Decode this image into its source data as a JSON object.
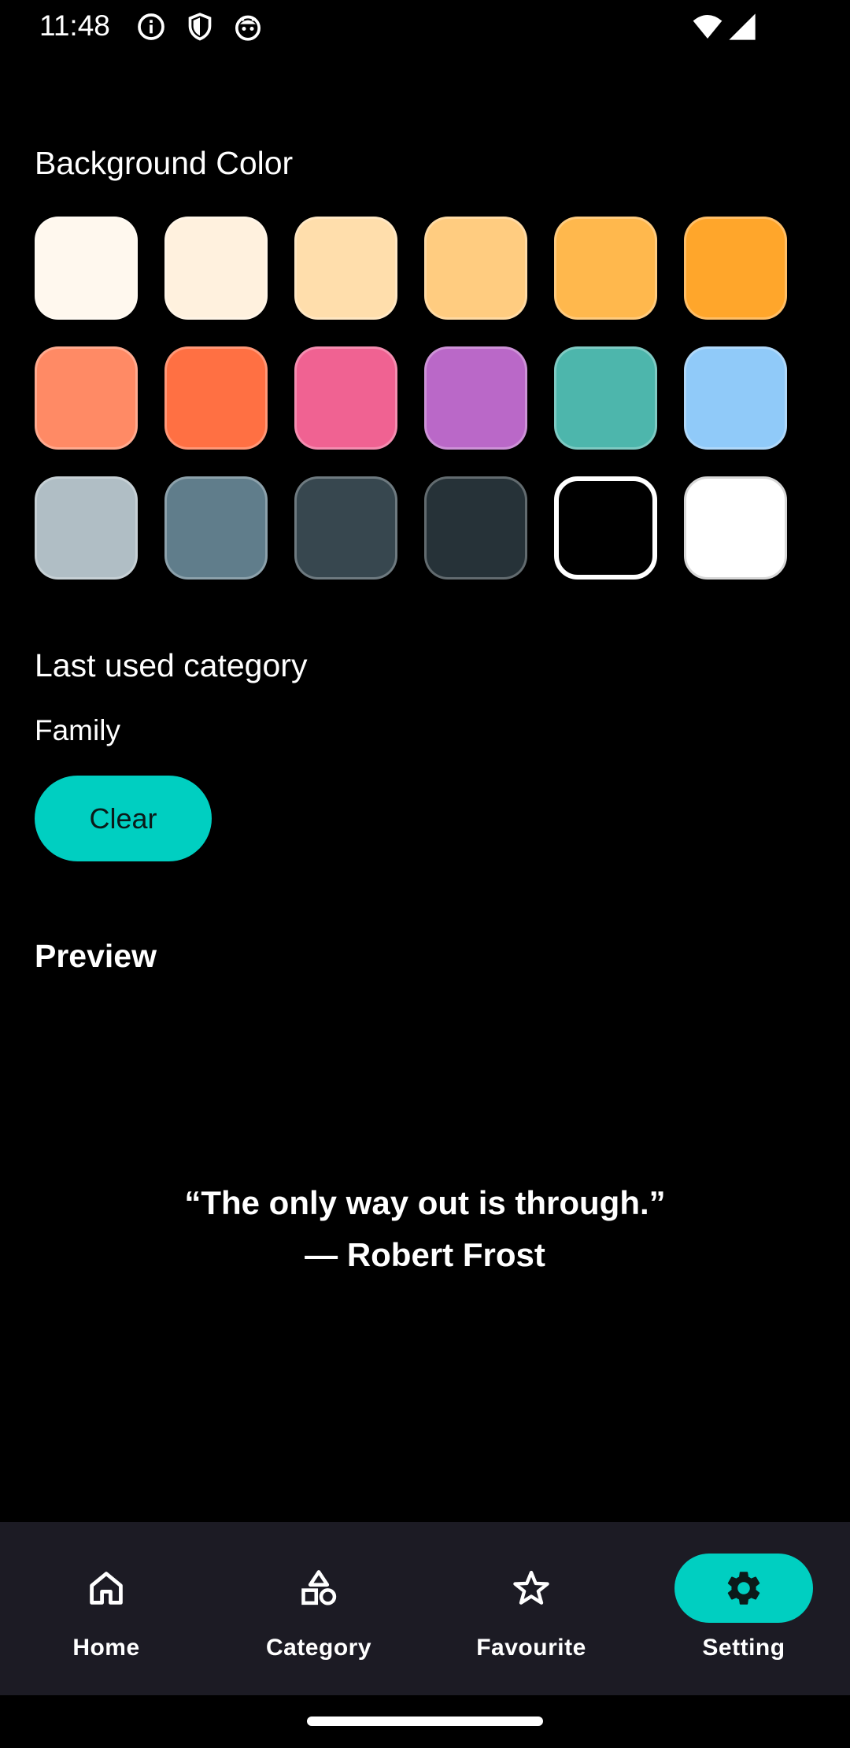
{
  "status_bar": {
    "time": "11:48",
    "left_icons": [
      "info-icon",
      "shield-icon",
      "android-icon"
    ],
    "right_icons": [
      "wifi-icon",
      "cellular-signal-icon"
    ]
  },
  "background_color": {
    "title": "Background Color",
    "selected_index": 16,
    "swatches": [
      "#FFF8EE",
      "#FFF1DE",
      "#FFDEAC",
      "#FFCC80",
      "#FFB84D",
      "#FFA62B",
      "#FF8A65",
      "#FF7043",
      "#F06292",
      "#BA68C8",
      "#4DB6AC",
      "#90CAF9",
      "#B0BEC5",
      "#607D8B",
      "#37474F",
      "#263238",
      "#000000",
      "#FFFFFF"
    ]
  },
  "last_used_category": {
    "title": "Last used category",
    "value": "Family",
    "clear_label": "Clear"
  },
  "preview": {
    "title": "Preview",
    "quote": "“The only way out is through.”",
    "author": "— Robert Frost"
  },
  "bottom_nav": {
    "items": [
      {
        "label": "Home",
        "icon": "home-icon",
        "active": false
      },
      {
        "label": "Category",
        "icon": "category-icon",
        "active": false
      },
      {
        "label": "Favourite",
        "icon": "star-icon",
        "active": false
      },
      {
        "label": "Setting",
        "icon": "gear-icon",
        "active": true
      }
    ]
  },
  "colors": {
    "accent": "#00CFC1",
    "nav_background": "#1C1B24",
    "page_background": "#000000"
  }
}
